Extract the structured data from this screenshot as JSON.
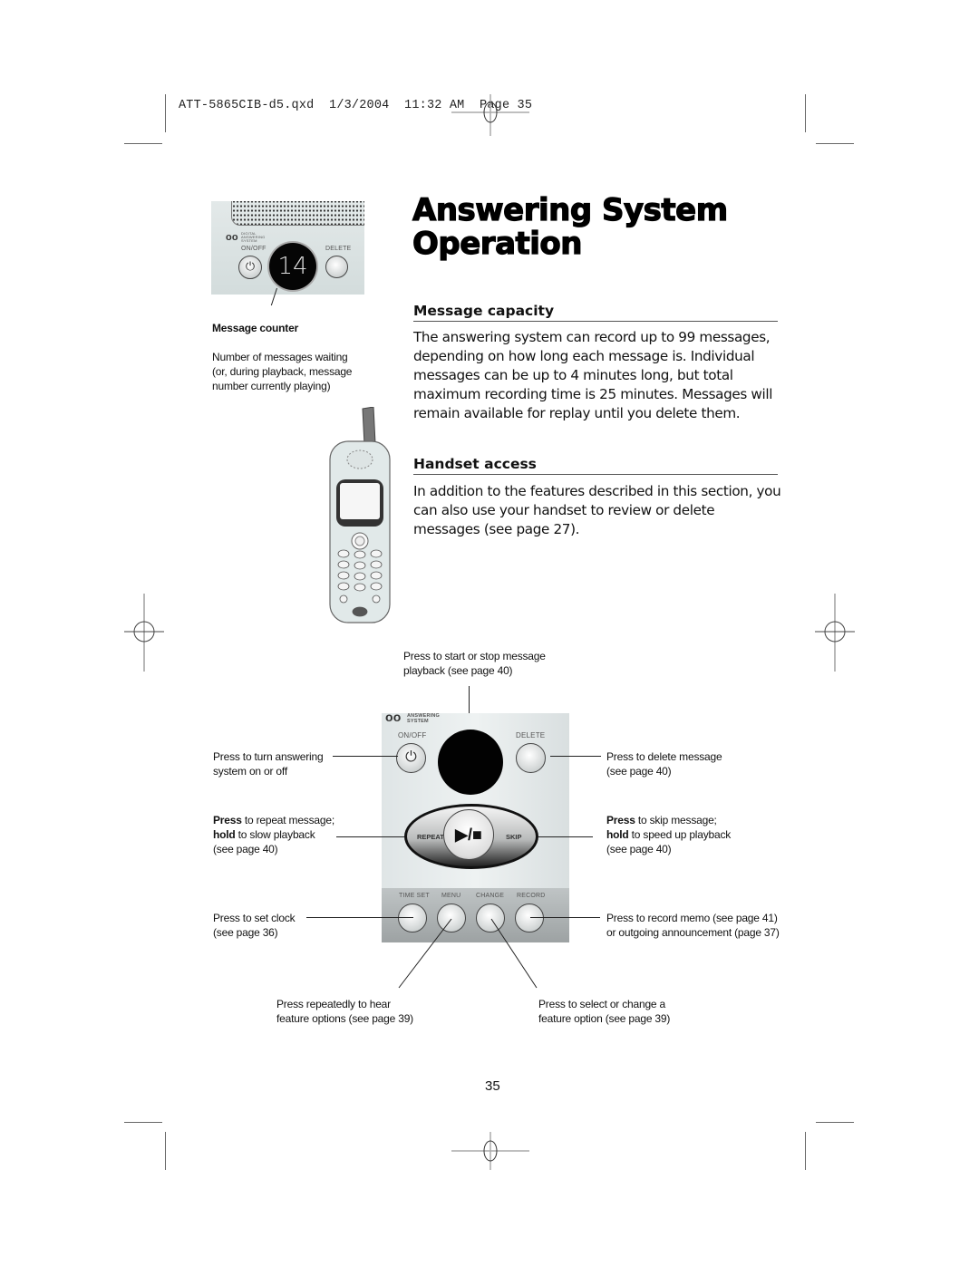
{
  "slug": "ATT-5865CIB-d5.qxd  1/3/2004  11:32 AM  Page 35",
  "title_line1": "Answering System",
  "title_line2": "Operation",
  "sections": [
    {
      "heading": "Message capacity",
      "body": "The answering system can record up to 99 messages, depending on how long each message is. Individual messages can be up to 4 minutes long, but total maximum recording time is 25 minutes. Messages will remain available for replay until you delete them."
    },
    {
      "heading": "Handset access",
      "body": "In addition to the features described in this section, you can also use your handset to review or delete messages (see page 27)."
    }
  ],
  "small_panel": {
    "logo_text": "DIGITAL ANSWERING SYSTEM",
    "onoff_label": "ON/OFF",
    "delete_label": "DELETE",
    "counter_value": "14"
  },
  "message_counter": {
    "heading": "Message counter",
    "description": "Number of messages waiting (or, during playback, message number currently playing)"
  },
  "big_panel": {
    "logo_text": "ANSWERING SYSTEM",
    "onoff_label": "ON/OFF",
    "delete_label": "DELETE",
    "repeat_label": "REPEAT",
    "skip_label": "SKIP",
    "play_stop_glyph": "▶/■",
    "bottom_labels": [
      "TIME SET",
      "MENU",
      "CHANGE",
      "RECORD"
    ]
  },
  "callouts": {
    "play_stop": "Press to start or stop message playback (see page 40)",
    "onoff": "Press to turn answering system on or off",
    "repeat_bold1": "Press",
    "repeat_rest1": " to repeat message;",
    "repeat_bold2": "hold",
    "repeat_rest2": " to slow playback",
    "repeat_line3": "(see page 40)",
    "delete": "Press to delete message (see page 40)",
    "skip_bold1": "Press",
    "skip_rest1": " to skip message;",
    "skip_bold2": "hold",
    "skip_rest2": " to speed up playback",
    "skip_line3": "(see page 40)",
    "timeset": "Press to set clock (see page 36)",
    "record": "Press to record memo (see page 41) or outgoing announcement (page 37)",
    "menu": "Press repeatedly to hear feature options (see page 39)",
    "change": "Press to select or change a feature option (see page 39)"
  },
  "page_number": "35"
}
